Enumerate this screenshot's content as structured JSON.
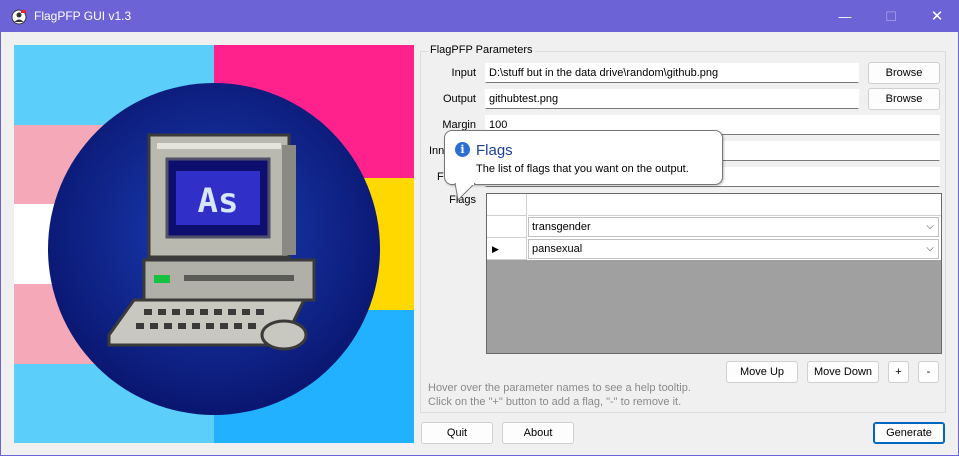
{
  "window": {
    "title": "FlagPFP GUI v1.3",
    "controls": {
      "minimize": "—",
      "maximize": "☐",
      "close": "✕"
    }
  },
  "preview": {
    "left_flag": "transgender",
    "right_flag": "pansexual",
    "colors": {
      "trans_blue": "#5bcefa",
      "trans_pink": "#f5a9b8",
      "trans_white": "#ffffff",
      "pan_pink": "#ff218c",
      "pan_yellow": "#ffd800",
      "pan_blue": "#21b1ff",
      "circle": "#0c1e8a"
    },
    "avatar_icon": "retro-computer-icon",
    "screen_text": "As"
  },
  "params": {
    "group_title": "FlagPFP Parameters",
    "input_label": "Input",
    "input_value": "D:\\stuff but in the data drive\\random\\github.png",
    "output_label": "Output",
    "output_value": "githubtest.png",
    "margin_label": "Margin",
    "margin_value": "100",
    "inner_label": "Inn",
    "inner_value": "",
    "fifth_label": "F",
    "fifth_value": "",
    "flags_label": "Flags",
    "browse_input": "Browse",
    "browse_output": "Browse"
  },
  "flags_grid": {
    "header": "",
    "rows": [
      {
        "flag": "transgender",
        "current": false,
        "marker": ""
      },
      {
        "flag": "pansexual",
        "current": true,
        "marker": "▶"
      }
    ],
    "combo_arrow": "⌵"
  },
  "flag_buttons": {
    "move_up": "Move Up",
    "move_down": "Move Down",
    "add": "+",
    "remove": "-"
  },
  "hint": {
    "line1": "Hover over the parameter names to see a help tooltip.",
    "line2": "Click on the \"+\" button to add a flag, \"-\" to remove it."
  },
  "tooltip": {
    "icon": "info-icon",
    "title": "Flags",
    "body": "The list of flags that you want on the output."
  },
  "footer": {
    "quit": "Quit",
    "about": "About",
    "generate": "Generate"
  }
}
